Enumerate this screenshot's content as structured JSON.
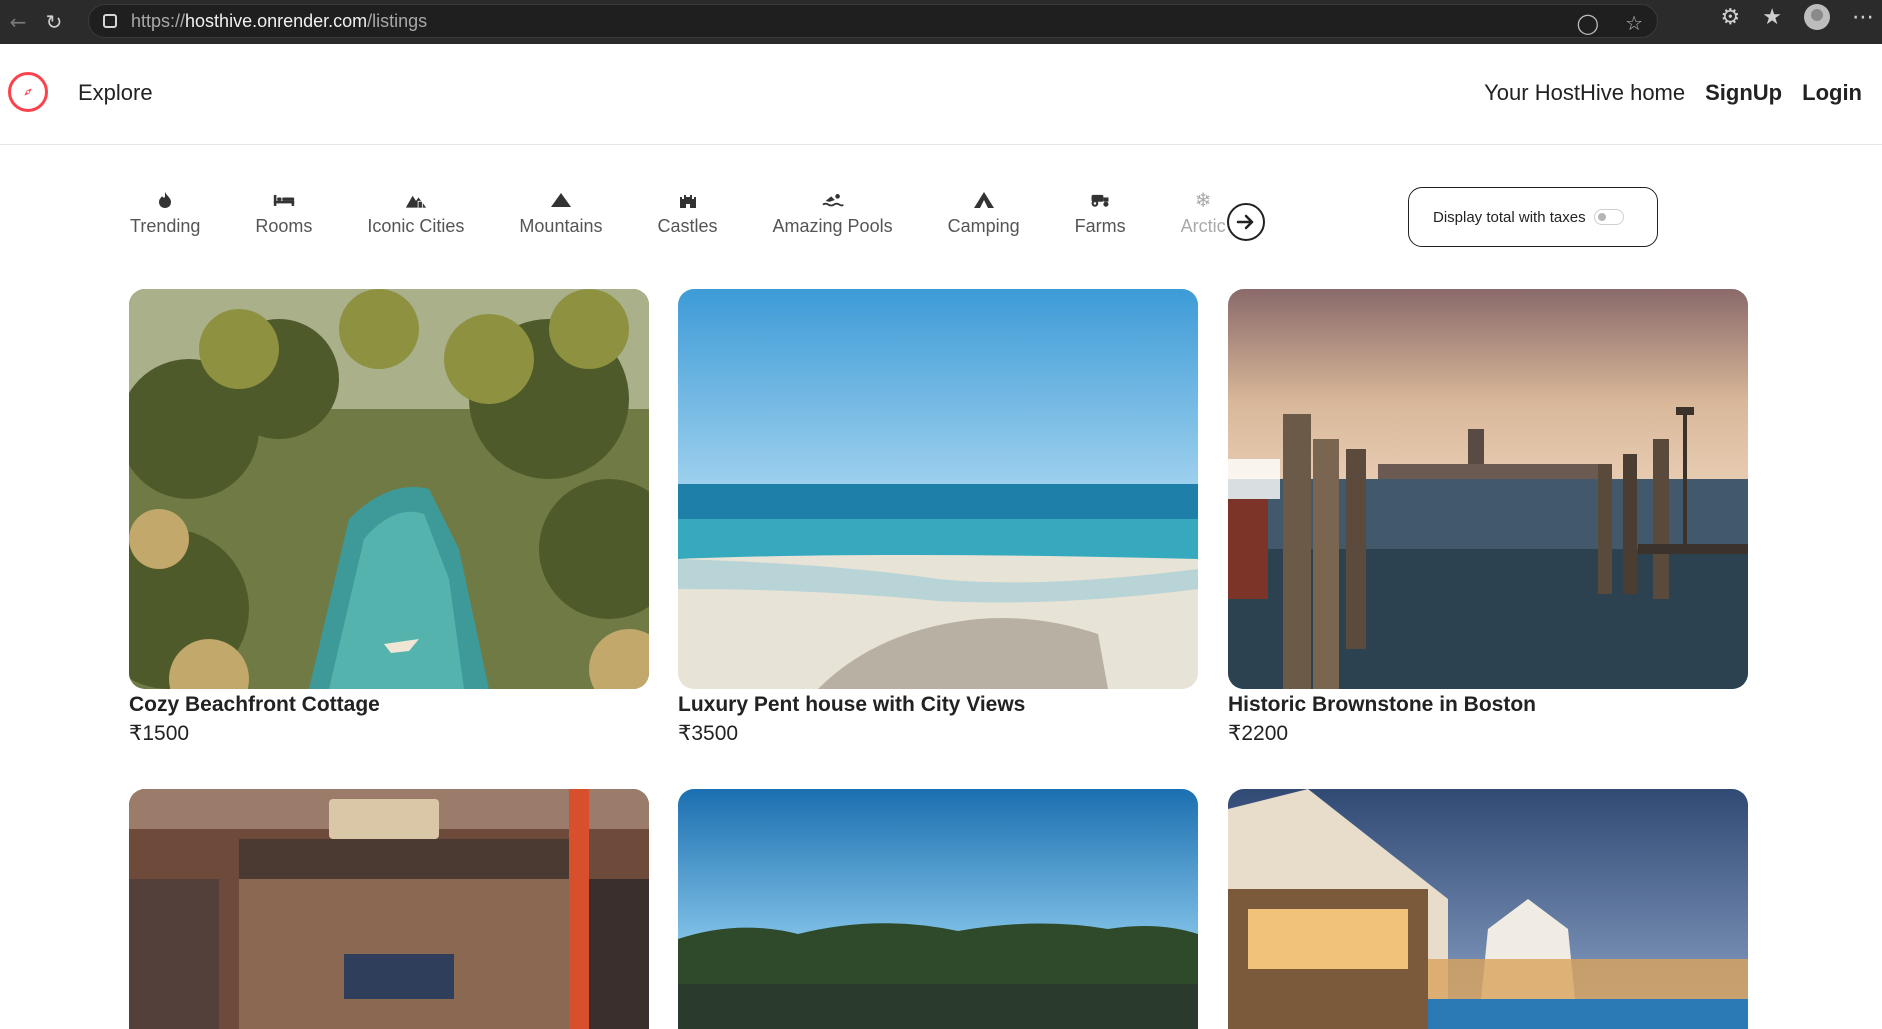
{
  "browser": {
    "url_scheme": "https://",
    "url_host": "hosthive.onrender.com",
    "url_path": "/listings"
  },
  "header": {
    "explore_label": "Explore",
    "home_link": "Your HostHive home",
    "signup_label": "SignUp",
    "login_label": "Login",
    "brand_color": "#fe424d"
  },
  "filters": {
    "items": [
      {
        "label": "Trending",
        "icon": "fire-icon"
      },
      {
        "label": "Rooms",
        "icon": "bed-icon"
      },
      {
        "label": "Iconic Cities",
        "icon": "city-icon"
      },
      {
        "label": "Mountains",
        "icon": "mountain-icon"
      },
      {
        "label": "Castles",
        "icon": "castle-icon"
      },
      {
        "label": "Amazing Pools",
        "icon": "swimmer-icon"
      },
      {
        "label": "Camping",
        "icon": "tent-icon"
      },
      {
        "label": "Farms",
        "icon": "tractor-icon"
      },
      {
        "label": "Arctic",
        "icon": "snowflake-icon"
      }
    ],
    "tax_toggle_label": "Display total with taxes"
  },
  "listings": [
    {
      "title": "Cozy Beachfront Cottage",
      "price": "₹1500"
    },
    {
      "title": "Luxury Pent house with City Views",
      "price": "₹3500"
    },
    {
      "title": "Historic Brownstone in Boston",
      "price": "₹2200"
    },
    {
      "title": "",
      "price": ""
    },
    {
      "title": "",
      "price": ""
    },
    {
      "title": "",
      "price": ""
    }
  ]
}
